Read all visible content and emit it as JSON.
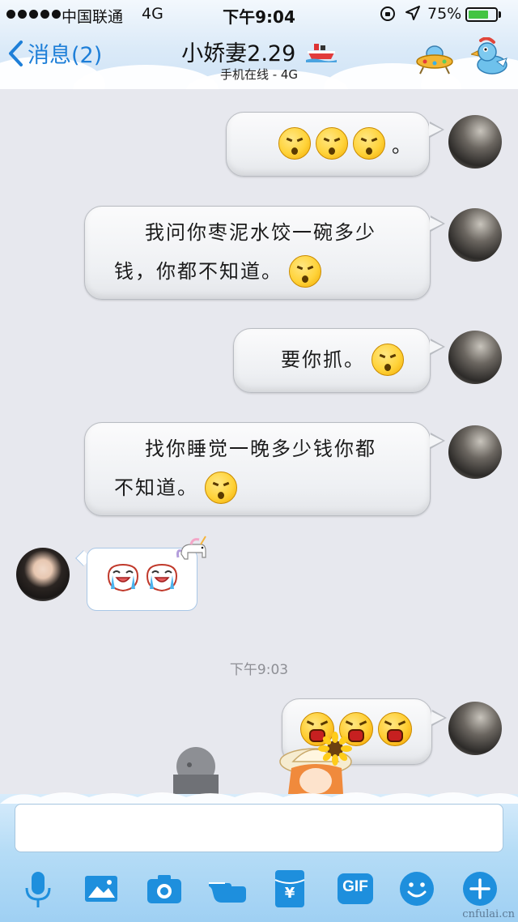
{
  "status_bar": {
    "carrier": "中国联通",
    "network": "4G",
    "time": "下午9:04",
    "battery_percent": "75%",
    "battery_level": 0.75,
    "battery_color": "#43c443"
  },
  "nav": {
    "back_label": "消息(2)",
    "title": "小娇妻2.29",
    "subtitle": "手机在线 - 4G",
    "accent_color": "#1e7fd8",
    "icons": [
      "chevron-left-icon",
      "ship-icon",
      "ufo-icon",
      "duck-icon"
    ]
  },
  "messages": [
    {
      "sender": "me",
      "text": "",
      "emojis": [
        "angry-emoji",
        "angry-emoji",
        "angry-emoji"
      ],
      "suffix": "。"
    },
    {
      "sender": "me",
      "line1": "我问你枣泥水饺一碗多少",
      "line2": "钱，你都不知道。",
      "emojis": [
        "angry-emoji"
      ]
    },
    {
      "sender": "me",
      "text": "要你抓。",
      "emojis": [
        "angry-emoji"
      ]
    },
    {
      "sender": "me",
      "line1": "找你睡觉一晚多少钱你都",
      "line2": "不知道。",
      "emojis": [
        "angry-emoji"
      ]
    },
    {
      "sender": "other",
      "emojis": [
        "crying-face",
        "crying-face"
      ]
    },
    {
      "sender": "me",
      "emojis": [
        "rage-emoji",
        "rage-emoji",
        "rage-emoji"
      ]
    }
  ],
  "timestamp": "下午9:03",
  "input": {
    "placeholder": ""
  },
  "toolbar": {
    "icons": [
      "microphone-icon",
      "image-icon",
      "camera-icon",
      "hand-icon",
      "red-packet-icon",
      "gif-icon",
      "emoji-icon",
      "plus-icon"
    ],
    "gif_label": "GIF",
    "red_packet_symbol": "¥"
  },
  "watermark": "cnfulai.cn"
}
